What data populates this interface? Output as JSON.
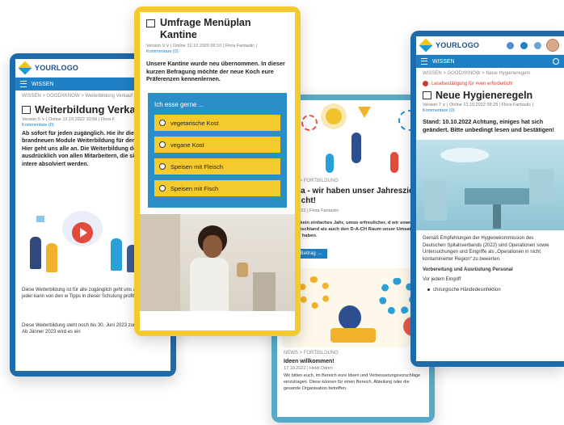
{
  "phone1": {
    "logo": "YOURLOGO",
    "nav_label": "WISSEN",
    "breadcrumb": "WISSEN > GOODXKNOW > Weiterbildung Verkauf",
    "title": "Weiterbildung Verka",
    "meta": "Version 5 ∨ | Online 12.10.2022 10:59 | Flora F",
    "comments": "Kommentare (0)",
    "lead": "Ab sofort für jeden zugänglich. Hie ihr die jeweils brandneuen Module Weiterbildung für den Verkauf. Hier geht uns alle an. Die Weiterbildung deswegen ausdrücklich von allen Mitarbeitern, die sich dafür intere absolviert werden.",
    "text1": "Diese Weiterbildung ist für alle zugänglich geht uns alle an und jeder kann von den w Tipps in dieser Schulung profitieren.",
    "text2": "Diese Weiterbildung steht noch bis 30. Juni 2023 zur Verfügung. Ab Jänner 2023 wird es ein"
  },
  "phone2": {
    "title": "Umfrage Menüplan Kantine",
    "meta": "Version 9 ∨ | Online 31.10.2020 09:10 | Flora Fantastic |",
    "comments": "Kommentare (0)",
    "lead": "Unsere Kantine wurde neu übernommen. In dieser kurzen Befragung möchte der neue Koch eure Präferenzen kennenlernen.",
    "question": "Ich esse gerne ...",
    "options": [
      "vegetarische Kost",
      "vegane Kost",
      "Speisen mit Fleisch",
      "Speisen mit Fisch"
    ]
  },
  "phone3": {
    "tag1": "NEWS > FORTBILDUNG",
    "headline1": "Hurra - wir haben unser Jahresziel erreicht!",
    "meta1": "17.10.2022 | Flora Fantastic",
    "text1": "Es war kein einfaches Jahr, umso erfreulicher, d wir sowohl für Deutschland als auch den D-A-CH Raum unser Umsatzziel erreicht haben.",
    "button": "Zum Beitrag →",
    "tag2": "NEWS > FORTBILDUNG",
    "headline2": "Ideen willkommen!",
    "meta2": "17.10.2022 | Heidi Dahm",
    "text2": "Wir bitten euch, im Bereich eure Ideen und Verbesserungsvorschläge einzutragen. Diese können für einen Bereich, Abteilung oder die gesamte Organisation betreffen."
  },
  "phone4": {
    "logo": "YOURLOGO",
    "nav_label": "WISSEN",
    "breadcrumb": "WISSEN > GOODXKNOW > Neue Hygieneregeln",
    "read_confirm": "Lesebestätigung für #ven erforderlich!",
    "title": "Neue Hygieneregeln",
    "meta": "Version 7 ∨ | Online 21.10.2022 09:29 | Flora Fantastic |",
    "comments": "Kommentare (0)",
    "lead": "Stand: 10.10.2022 Achtung, einiges hat sich geändert. Bitte unbedingt lesen und bestätigen!",
    "text1": "Gemäß Empfehlungen der Hygienekommission des Deutschen Spitalsverbands (2022) sind Operationen sowie Untersuchungen und Eingriffe als „Operationen in nicht kontaminierter Region“ zu bewerten.",
    "sub": "Vorbereitung und Ausrüstung Personal",
    "text2": "Vor jedem Eingriff",
    "bullet": "chirurgische Händedesinfektion"
  }
}
